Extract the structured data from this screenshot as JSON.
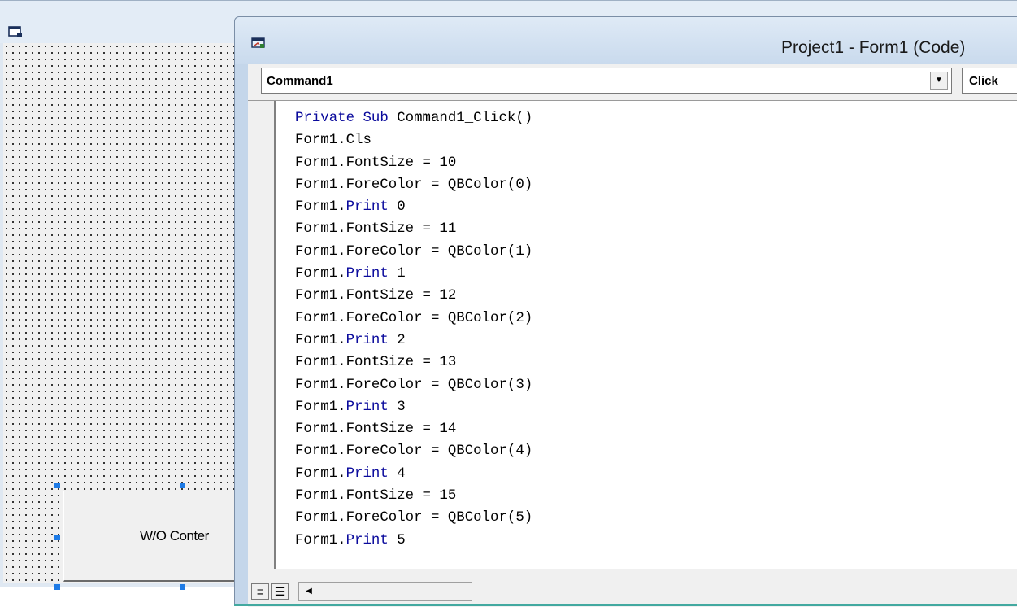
{
  "form_window": {
    "icon": "form-window-icon",
    "command_button_caption": "W/O Conter"
  },
  "code_window": {
    "icon": "code-window-icon",
    "title": "Project1 - Form1 (Code)",
    "object_combo": {
      "value": "Command1",
      "arrow": "▼"
    },
    "procedure_combo": {
      "value": "Click"
    },
    "code_lines": [
      [
        {
          "t": "Private Sub",
          "kw": true
        },
        {
          "t": " Command1_Click()"
        }
      ],
      [
        {
          "t": "Form1.Cls"
        }
      ],
      [
        {
          "t": "Form1.FontSize = 10"
        }
      ],
      [
        {
          "t": "Form1.ForeColor = QBColor(0)"
        }
      ],
      [
        {
          "t": "Form1."
        },
        {
          "t": "Print",
          "kw": true
        },
        {
          "t": " 0"
        }
      ],
      [
        {
          "t": "Form1.FontSize = 11"
        }
      ],
      [
        {
          "t": "Form1.ForeColor = QBColor(1)"
        }
      ],
      [
        {
          "t": "Form1."
        },
        {
          "t": "Print",
          "kw": true
        },
        {
          "t": " 1"
        }
      ],
      [
        {
          "t": "Form1.FontSize = 12"
        }
      ],
      [
        {
          "t": "Form1.ForeColor = QBColor(2)"
        }
      ],
      [
        {
          "t": "Form1."
        },
        {
          "t": "Print",
          "kw": true
        },
        {
          "t": " 2"
        }
      ],
      [
        {
          "t": "Form1.FontSize = 13"
        }
      ],
      [
        {
          "t": "Form1.ForeColor = QBColor(3)"
        }
      ],
      [
        {
          "t": "Form1."
        },
        {
          "t": "Print",
          "kw": true
        },
        {
          "t": " 3"
        }
      ],
      [
        {
          "t": "Form1.FontSize = 14"
        }
      ],
      [
        {
          "t": "Form1.ForeColor = QBColor(4)"
        }
      ],
      [
        {
          "t": "Form1."
        },
        {
          "t": "Print",
          "kw": true
        },
        {
          "t": " 4"
        }
      ],
      [
        {
          "t": "Form1.FontSize = 15"
        }
      ],
      [
        {
          "t": "Form1.ForeColor = QBColor(5)"
        }
      ],
      [
        {
          "t": "Form1."
        },
        {
          "t": "Print",
          "kw": true
        },
        {
          "t": " 5"
        }
      ]
    ],
    "keyword_color": "#0a0a9c",
    "bottom_bar": {
      "procedure_view_glyph": "≡",
      "full_module_view_glyph": "☰",
      "scroll_left_glyph": "◀"
    }
  }
}
